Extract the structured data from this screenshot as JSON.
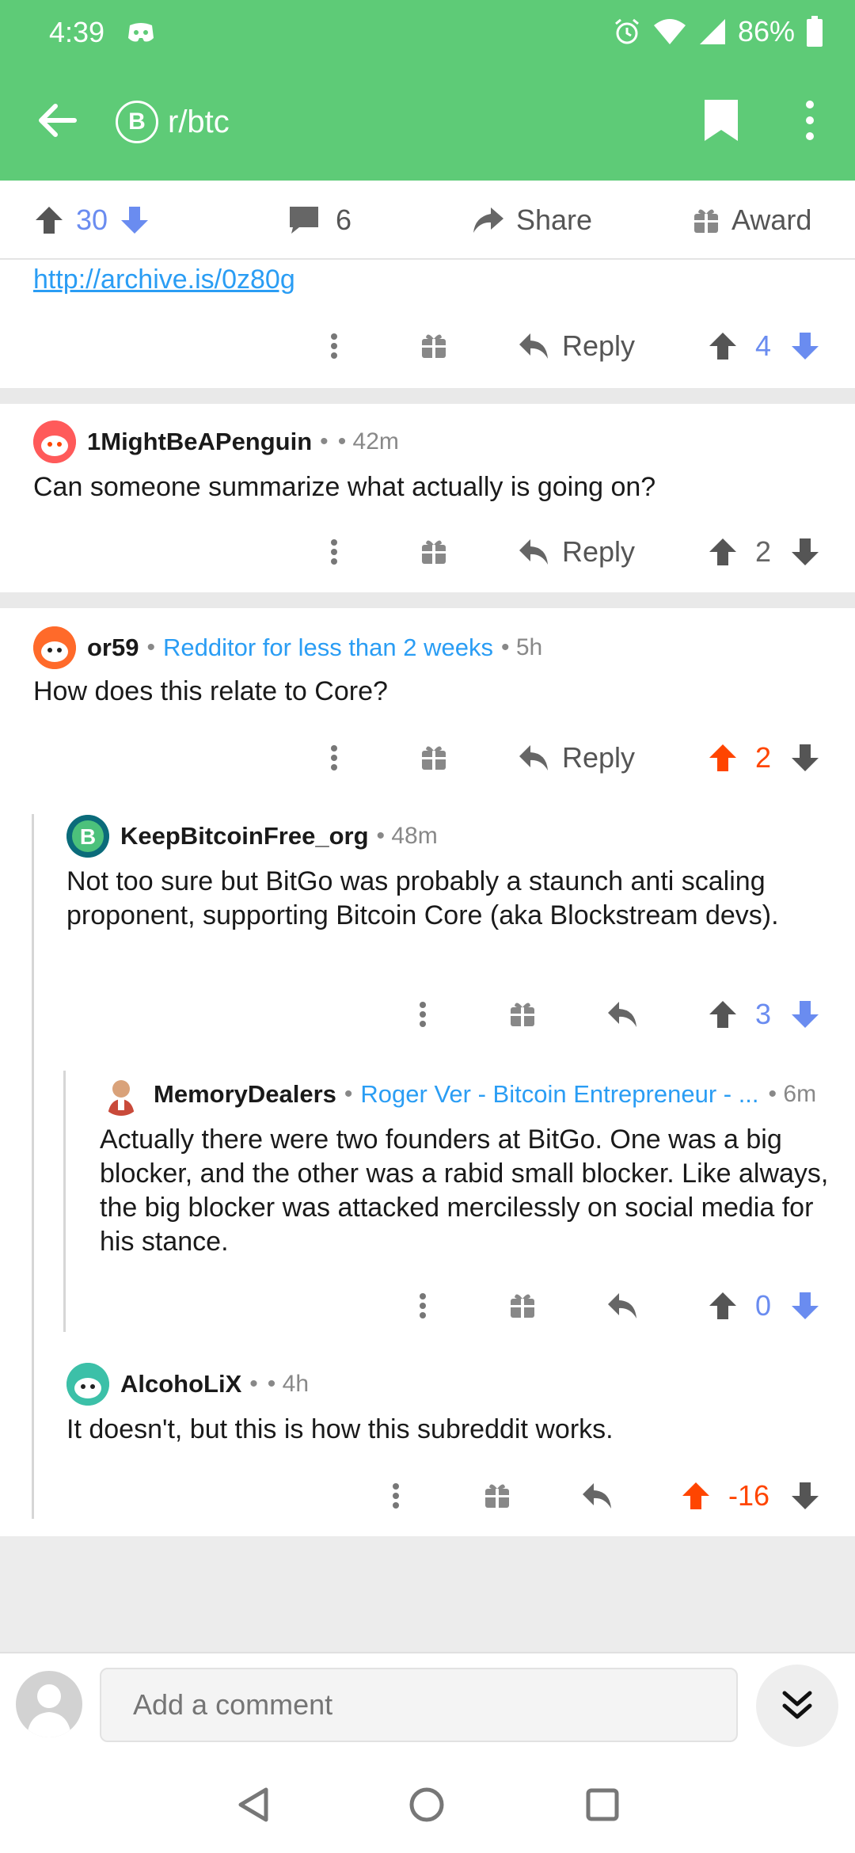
{
  "status_bar": {
    "time": "4:39",
    "battery": "86%"
  },
  "app_bar": {
    "subreddit": "r/btc",
    "subreddit_icon": "B"
  },
  "post_actions": {
    "upvotes": "30",
    "comments": "6",
    "share": "Share",
    "award": "Award"
  },
  "link_text": "http://archive.is/0z80g",
  "comments": [
    {
      "id": "c0",
      "reply": "Reply",
      "score": "4",
      "vote_state": "none"
    },
    {
      "id": "c1",
      "author": "1MightBeAPenguin",
      "flair": "",
      "age": "• 42m",
      "body": "Can someone summarize what actually is going on?",
      "reply": "Reply",
      "score": "2",
      "vote_state": "neutral"
    },
    {
      "id": "c2",
      "author": "or59",
      "flair": "Redditor for less than 2 weeks",
      "age": "• 5h",
      "body": "How does this relate to Core?",
      "reply": "Reply",
      "score": "2",
      "vote_state": "upvoted"
    },
    {
      "id": "c3",
      "author": "KeepBitcoinFree_org",
      "age": "• 48m",
      "body": "Not too sure but BitGo was probably a staunch anti scaling proponent, supporting Bitcoin Core (aka Blockstream devs).",
      "score": "3",
      "vote_state": "none"
    },
    {
      "id": "c4",
      "author": "MemoryDealers",
      "flair": "Roger Ver - Bitcoin Entrepreneur - ...",
      "age": "• 6m",
      "body": "Actually there were two founders at BitGo. One was a big blocker, and the other was a rabid small blocker.  Like always, the big blocker was attacked mercilessly on social media for his stance.",
      "score": "0",
      "vote_state": "none"
    },
    {
      "id": "c5",
      "author": "AlcohoLiX",
      "flair": "",
      "age": "• 4h",
      "body": "It doesn't, but this is how this subreddit works.",
      "score": "-16",
      "vote_state": "upvoted"
    }
  ],
  "composer": {
    "placeholder": "Add a comment"
  },
  "colors": {
    "app_bar": "#5ecb77",
    "upvote": "#ff4500",
    "vote_blue": "#6a8cf0",
    "flair": "#2a9df4"
  }
}
